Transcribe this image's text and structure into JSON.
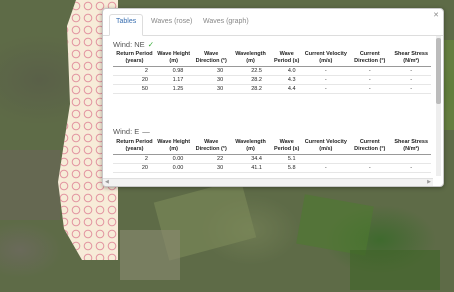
{
  "tabs": [
    {
      "label": "Tables",
      "active": true
    },
    {
      "label": "Waves (rose)",
      "active": false
    },
    {
      "label": "Waves (graph)",
      "active": false
    }
  ],
  "columns": [
    "Return Period (years)",
    "Wave Height (m)",
    "Wave Direction (°)",
    "Wavelength (m)",
    "Wave Period (s)",
    "Current Velocity (m/s)",
    "Current Direction (°)",
    "Shear Stress (N/m²)"
  ],
  "groups": [
    {
      "title": "Wind: NE",
      "checked": true,
      "rows": [
        [
          "2",
          "0.98",
          "30",
          "22.5",
          "4.0",
          "-",
          "-",
          "-"
        ],
        [
          "20",
          "1.17",
          "30",
          "28.2",
          "4.3",
          "-",
          "-",
          "-"
        ],
        [
          "50",
          "1.25",
          "30",
          "28.2",
          "4.4",
          "-",
          "-",
          "-"
        ]
      ]
    },
    {
      "title": "Wind: E",
      "checked": false,
      "rows": [
        [
          "2",
          "0.00",
          "22",
          "34.4",
          "5.1",
          "",
          "",
          ""
        ],
        [
          "20",
          "0.00",
          "30",
          "41.1",
          "5.8",
          "-",
          "-",
          "-"
        ]
      ]
    }
  ],
  "colors": {
    "accent": "#3a6fb0",
    "map_water": "#f7ecd8",
    "map_land": "#5e6b47"
  }
}
